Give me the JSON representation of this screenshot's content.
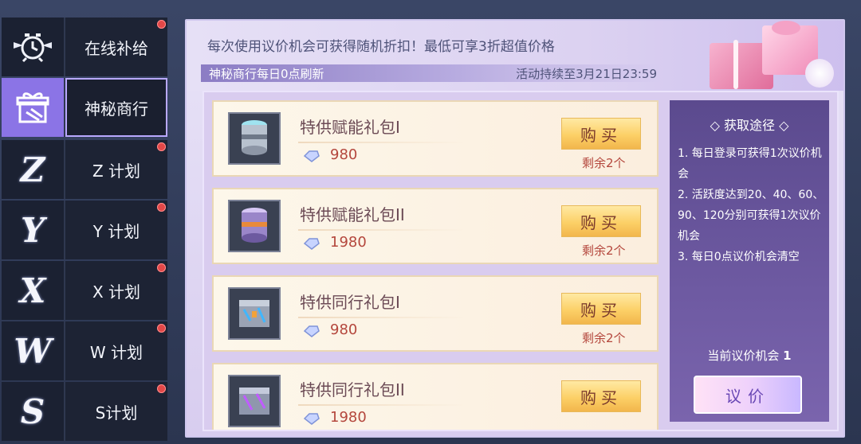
{
  "sidebar": {
    "items": [
      {
        "label": "在线补给",
        "icon": "alarm-clock-icon",
        "badge": true
      },
      {
        "label": "神秘商行",
        "icon": "gift-icon",
        "badge": false,
        "active": true
      },
      {
        "label": "Z 计划",
        "icon": "z-letter-icon",
        "badge": true,
        "letter": "Z"
      },
      {
        "label": "Y 计划",
        "icon": "y-letter-icon",
        "badge": true,
        "letter": "Y"
      },
      {
        "label": "X 计划",
        "icon": "x-letter-icon",
        "badge": true,
        "letter": "X"
      },
      {
        "label": "W 计划",
        "icon": "w-letter-icon",
        "badge": true,
        "letter": "W"
      },
      {
        "label": "S计划",
        "icon": "s-letter-icon",
        "badge": true,
        "letter": "S"
      }
    ]
  },
  "header": {
    "text": "每次使用议价机会可获得随机折扣！最低可享3折超值价格",
    "refresh_label": "神秘商行每日0点刷新",
    "duration": "活动持续至3月21日23:59"
  },
  "items": [
    {
      "name": "特供赋能礼包I",
      "price": "980",
      "buy_label": "购买",
      "remain": "剩余2个"
    },
    {
      "name": "特供赋能礼包II",
      "price": "1980",
      "buy_label": "购买",
      "remain": "剩余2个"
    },
    {
      "name": "特供同行礼包I",
      "price": "980",
      "buy_label": "购买",
      "remain": "剩余2个"
    },
    {
      "name": "特供同行礼包II",
      "price": "1980",
      "buy_label": "购买",
      "remain": ""
    }
  ],
  "info": {
    "title": "获取途径",
    "rules": [
      "1.  每日登录可获得1次议价机会",
      "2.  活跃度达到20、40、60、90、120分别可获得1次议价机会",
      "3.  每日0点议价机会清空"
    ],
    "chance_label": "当前议价机会",
    "chance_count": "1",
    "bargain_label": "议价"
  },
  "colors": {
    "accent": "#8b74e6",
    "badge": "#e24848",
    "price": "#b4473d",
    "buy_button": "#fcd067"
  }
}
